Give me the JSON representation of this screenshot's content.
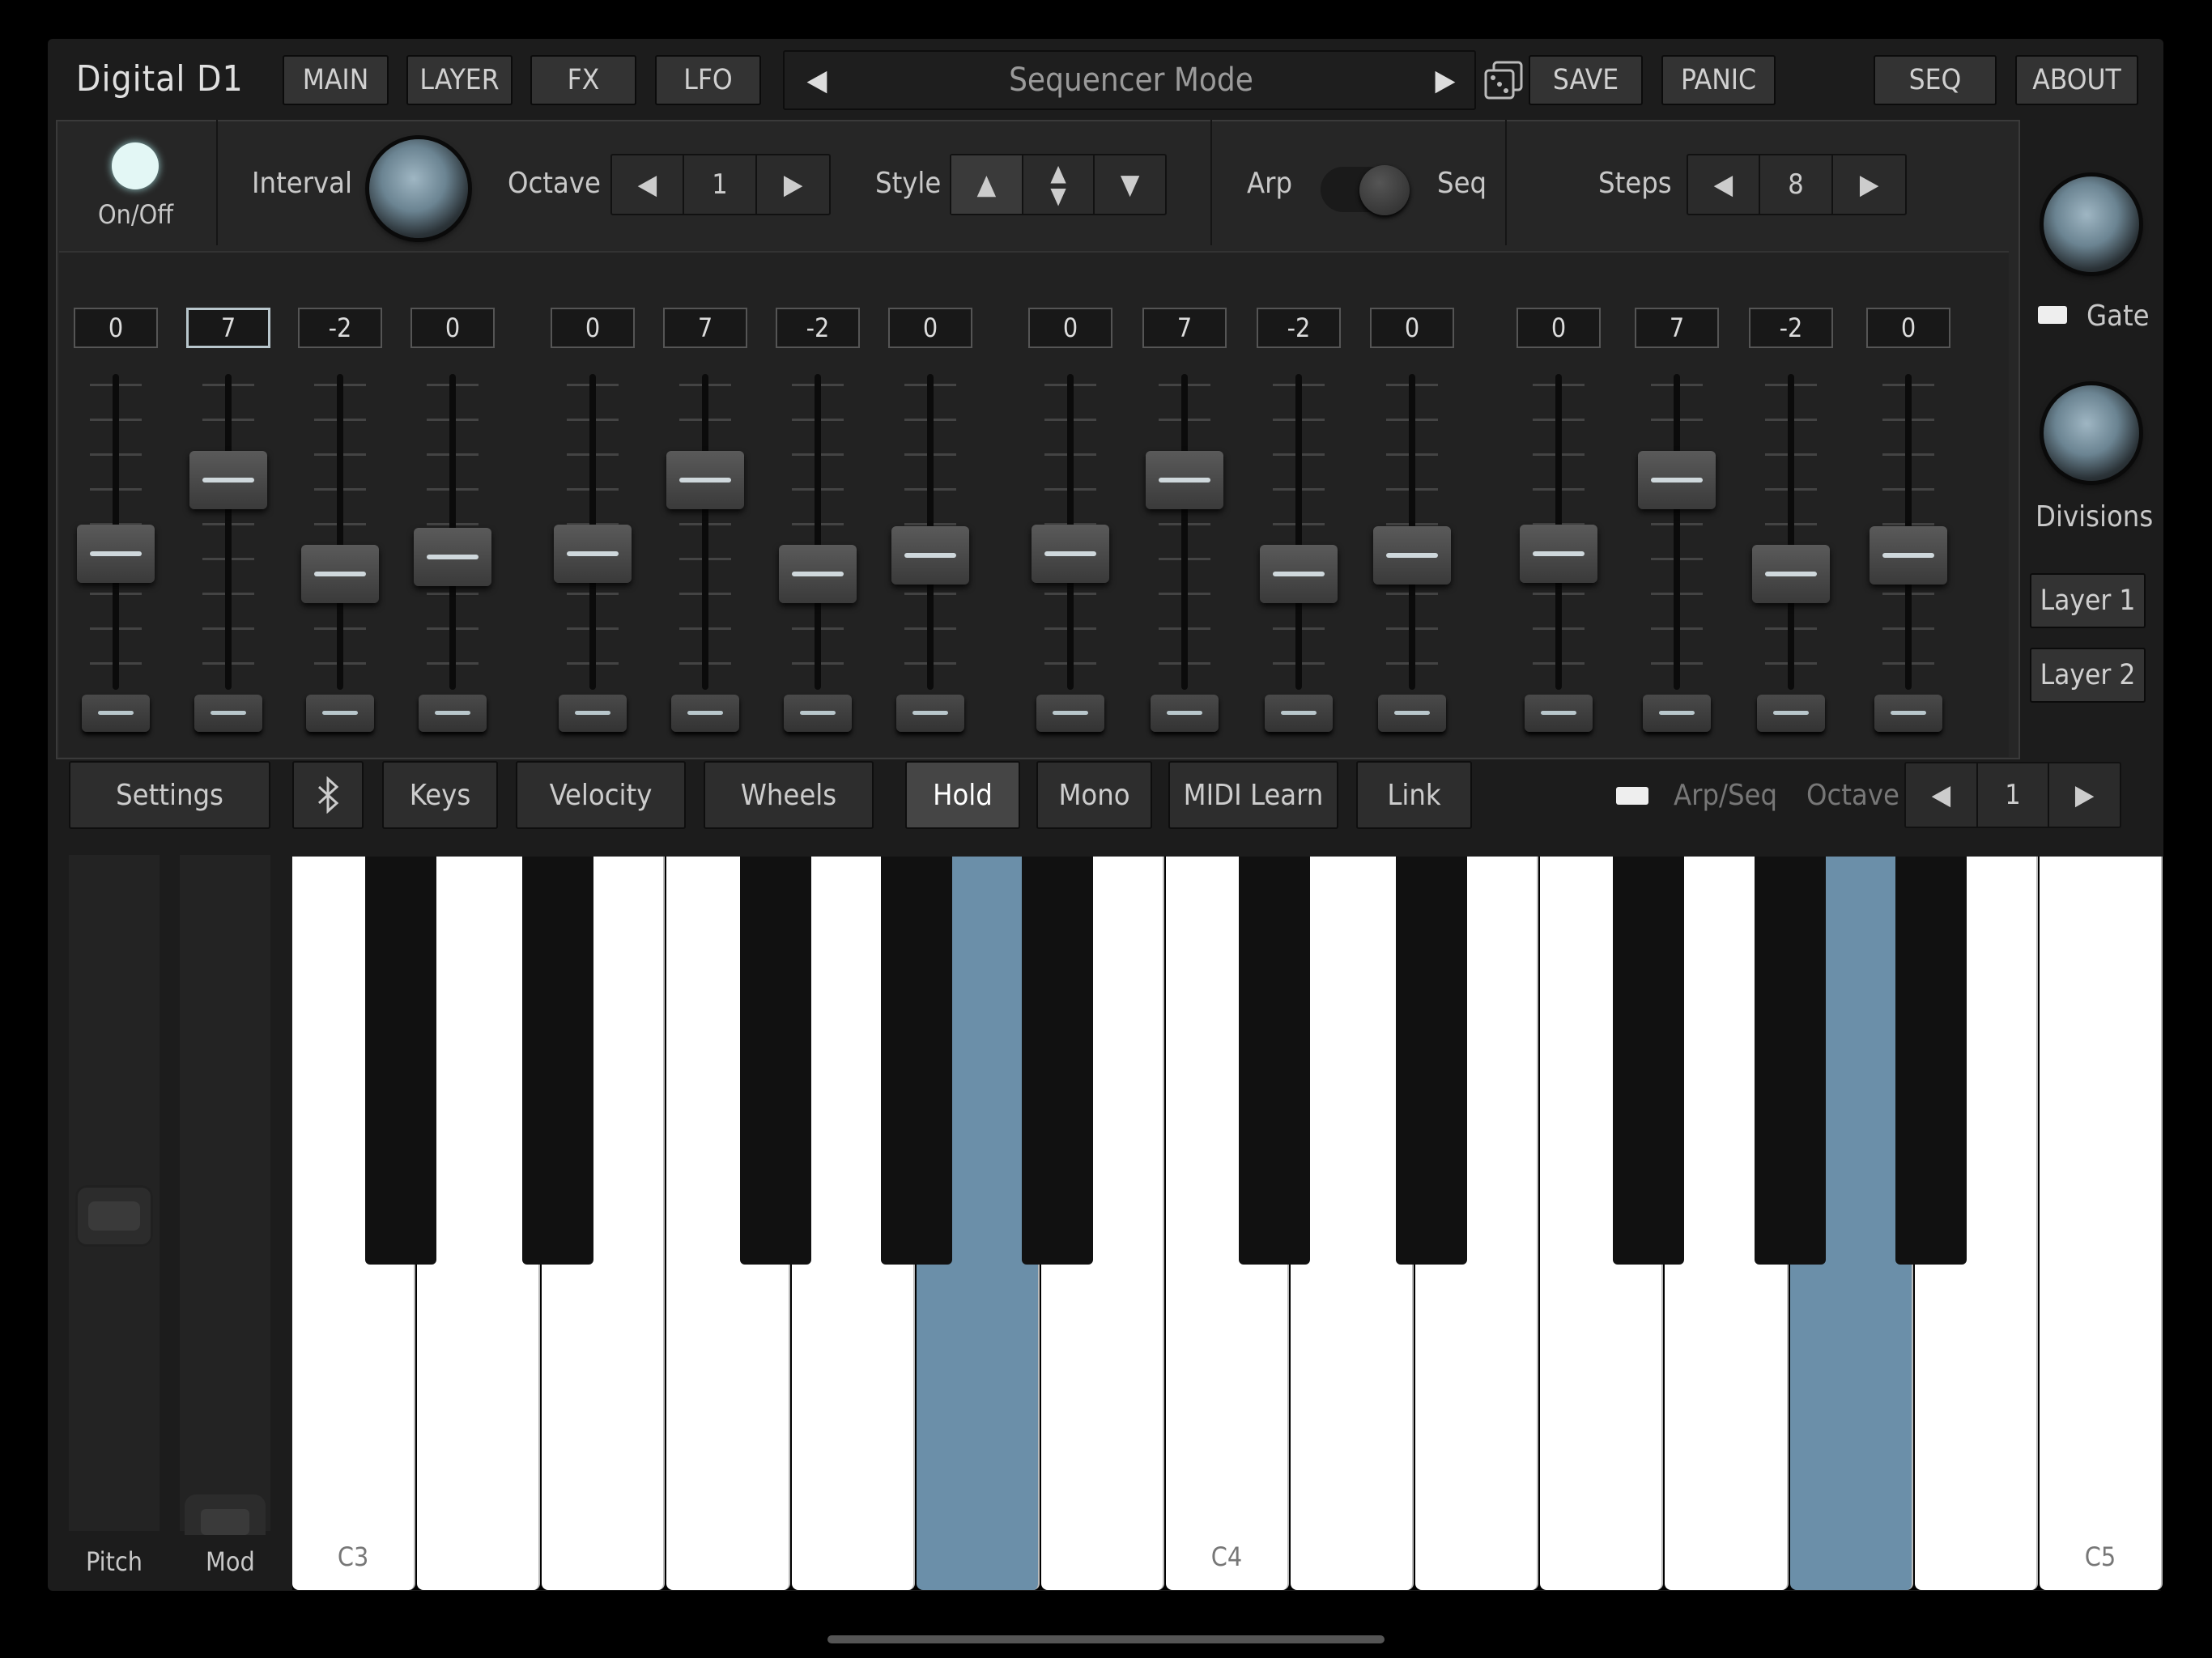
{
  "header": {
    "logo": "Digital D1",
    "nav": [
      "MAIN",
      "LAYER",
      "FX",
      "LFO"
    ],
    "preset_name": "Sequencer Mode",
    "save": "SAVE",
    "panic": "PANIC",
    "seq": "SEQ",
    "about": "ABOUT"
  },
  "controls": {
    "onoff_label": "On/Off",
    "interval_label": "Interval",
    "octave_label": "Octave",
    "octave_value": "1",
    "style_label": "Style",
    "arp_label": "Arp",
    "seq_label": "Seq",
    "steps_label": "Steps",
    "steps_value": "8"
  },
  "sequencer": {
    "step_values": [
      "0",
      "7",
      "-2",
      "0",
      "0",
      "7",
      "-2",
      "0",
      "0",
      "7",
      "-2",
      "0",
      "0",
      "7",
      "-2",
      "0"
    ],
    "selected_step": 2
  },
  "side": {
    "gate_label": "Gate",
    "divisions_label": "Divisions",
    "layer1": "Layer 1",
    "layer2": "Layer 2"
  },
  "toolbar": {
    "settings": "Settings",
    "keys": "Keys",
    "velocity": "Velocity",
    "wheels": "Wheels",
    "hold": "Hold",
    "mono": "Mono",
    "midi_learn": "MIDI Learn",
    "link": "Link",
    "arpseq_label": "Arp/Seq",
    "octave_label": "Octave",
    "octave_value": "1"
  },
  "wheels": {
    "pitch_label": "Pitch",
    "mod_label": "Mod"
  },
  "keyboard": {
    "labels": {
      "c3": "C3",
      "c4": "C4",
      "c5": "C5"
    },
    "pressed_keys": [
      "A3",
      "A4"
    ],
    "pressed_color": "#6b8fa9"
  },
  "colors": {
    "accent": "#6b8fa9",
    "led_on": "#e3f7f5"
  }
}
